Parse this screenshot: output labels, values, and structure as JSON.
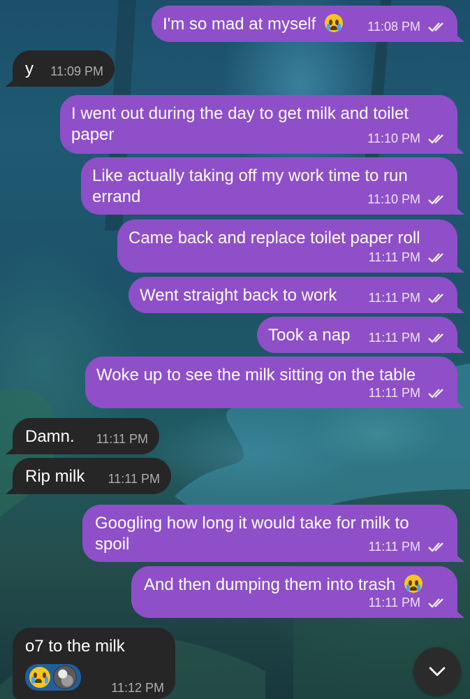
{
  "messages": [
    {
      "dir": "out",
      "text": "I'm so mad at myself",
      "emoji": "loudly-crying-face",
      "time": "11:08 PM",
      "status": "read"
    },
    {
      "dir": "in",
      "text": "y",
      "time": "11:09 PM"
    },
    {
      "dir": "out",
      "text": "I went out during the day to get milk and toilet paper",
      "time": "11:10 PM",
      "status": "read"
    },
    {
      "dir": "out",
      "text": "Like actually taking off my work time to run errand",
      "time": "11:10 PM",
      "status": "read"
    },
    {
      "dir": "out",
      "text": "Came back and replace toilet paper roll",
      "time": "11:11 PM",
      "status": "read"
    },
    {
      "dir": "out",
      "text": "Went straight back to work",
      "time": "11:11 PM",
      "status": "read"
    },
    {
      "dir": "out",
      "text": "Took a nap",
      "time": "11:11 PM",
      "status": "read"
    },
    {
      "dir": "out",
      "text": "Woke up to see the milk sitting on the table",
      "time": "11:11 PM",
      "status": "read"
    },
    {
      "dir": "in",
      "text": "Damn.",
      "time": "11:11 PM"
    },
    {
      "dir": "in",
      "text": "Rip milk",
      "time": "11:11 PM"
    },
    {
      "dir": "out",
      "text": "Googling how long it would take for milk to spoil",
      "time": "11:11 PM",
      "status": "read"
    },
    {
      "dir": "out",
      "text": "And then dumping them into trash",
      "emoji": "loudly-crying-face",
      "time": "11:11 PM",
      "status": "read"
    },
    {
      "dir": "in",
      "text": "o7 to the milk",
      "time": "11:12 PM",
      "reaction": {
        "emoji": "loudly-crying-face",
        "has_avatar": true
      }
    }
  ],
  "colors": {
    "outgoing": "#8e4fc9",
    "incoming": "#262626",
    "reaction": "#1f5f9f"
  },
  "icons": {
    "read_receipt": "double-check-icon",
    "scroll_down": "chevron-down-icon"
  }
}
